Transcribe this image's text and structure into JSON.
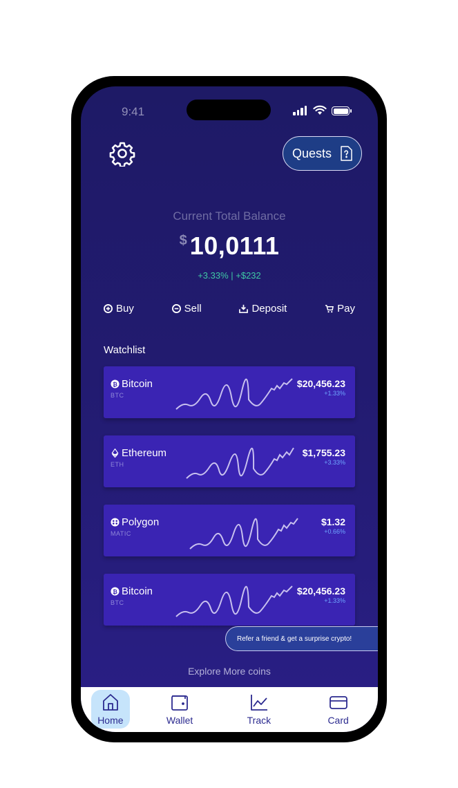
{
  "status_bar": {
    "time": "9:41"
  },
  "header": {
    "quests_label": "Quests"
  },
  "balance": {
    "label": "Current Total Balance",
    "currency": "$",
    "amount": "10,0111",
    "change": "+3.33% | +$232"
  },
  "actions": [
    {
      "label": "Buy",
      "icon": "plus-circle-icon"
    },
    {
      "label": "Sell",
      "icon": "minus-circle-icon"
    },
    {
      "label": "Deposit",
      "icon": "download-tray-icon"
    },
    {
      "label": "Pay",
      "icon": "cart-icon"
    }
  ],
  "watchlist": {
    "title": "Watchlist",
    "items": [
      {
        "name": "Bitcoin",
        "symbol": "BTC",
        "price": "$20,456.23",
        "change": "+1.33%",
        "icon": "bitcoin-icon"
      },
      {
        "name": "Ethereum",
        "symbol": "ETH",
        "price": "$1,755.23",
        "change": "+3.33%",
        "icon": "ethereum-icon"
      },
      {
        "name": "Polygon",
        "symbol": "MATIC",
        "price": "$1.32",
        "change": "+0.66%",
        "icon": "polygon-icon"
      },
      {
        "name": "Bitcoin",
        "symbol": "BTC",
        "price": "$20,456.23",
        "change": "+1.33%",
        "icon": "bitcoin-icon"
      }
    ]
  },
  "refer_toast": "Refer a friend & get a surprise crypto!",
  "explore_label": "Explore More coins",
  "nav": [
    {
      "label": "Home",
      "icon": "home-icon",
      "active": true
    },
    {
      "label": "Wallet",
      "icon": "wallet-icon",
      "active": false
    },
    {
      "label": "Track",
      "icon": "chart-line-icon",
      "active": false
    },
    {
      "label": "Card",
      "icon": "credit-card-icon",
      "active": false
    }
  ],
  "colors": {
    "background": "#221b70",
    "card": "#3a24b3",
    "positive": "#3fc9a4",
    "accent": "#6ea6ff",
    "nav_active": "#c6e4fb"
  }
}
